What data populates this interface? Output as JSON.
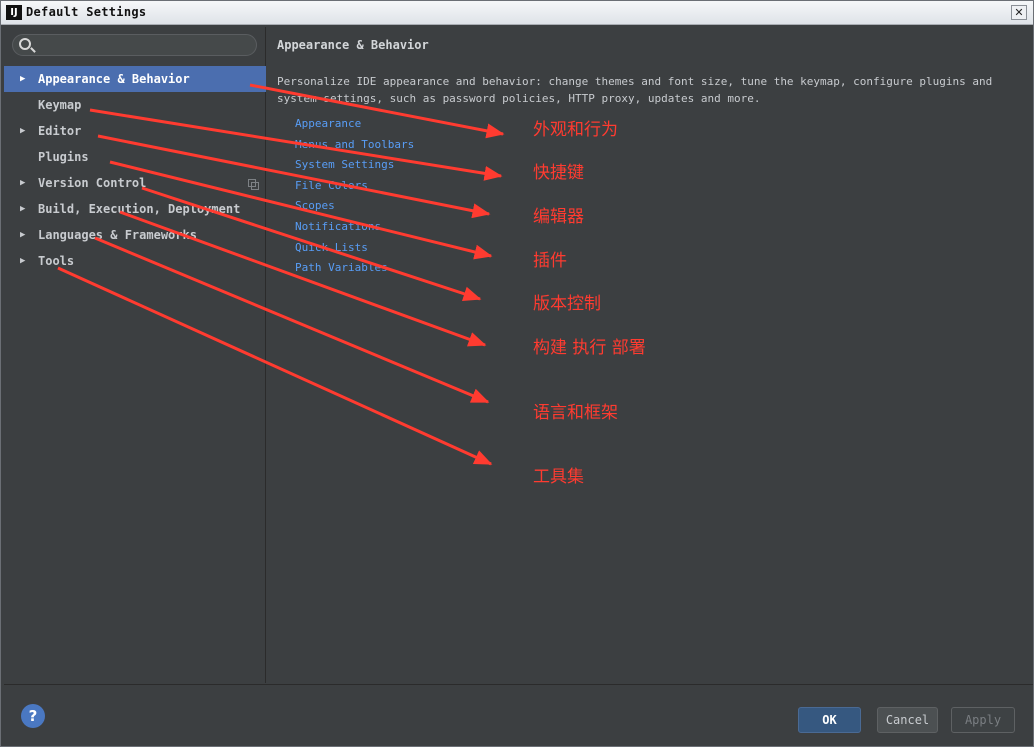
{
  "window": {
    "title": "Default Settings",
    "app_icon_text": "IJ",
    "close_symbol": "✕"
  },
  "sidebar": {
    "search_placeholder": "",
    "items": [
      {
        "label": "Appearance & Behavior",
        "expandable": true,
        "selected": true
      },
      {
        "label": "Keymap",
        "expandable": false,
        "selected": false
      },
      {
        "label": "Editor",
        "expandable": true,
        "selected": false
      },
      {
        "label": "Plugins",
        "expandable": false,
        "selected": false
      },
      {
        "label": "Version Control",
        "expandable": true,
        "selected": false
      },
      {
        "label": "Build, Execution, Deployment",
        "expandable": true,
        "selected": false
      },
      {
        "label": "Languages & Frameworks",
        "expandable": true,
        "selected": false
      },
      {
        "label": "Tools",
        "expandable": true,
        "selected": false
      }
    ],
    "arrow_symbol": "▶"
  },
  "content": {
    "breadcrumb": "Appearance & Behavior",
    "description": "Personalize IDE appearance and behavior: change themes and font size, tune the keymap, configure plugins and system settings, such as password policies, HTTP proxy, updates and more.",
    "links": [
      "Appearance",
      "Menus and Toolbars",
      "System Settings",
      "File Colors",
      "Scopes",
      "Notifications",
      "Quick Lists",
      "Path Variables"
    ]
  },
  "buttons": {
    "help": "?",
    "ok": "OK",
    "cancel": "Cancel",
    "apply": "Apply"
  },
  "annotations": {
    "color": "#ff3b30",
    "labels": [
      "外观和行为",
      "快捷键",
      "编辑器",
      "插件",
      "版本控制",
      "构建 执行 部署",
      "语言和框架",
      "工具集"
    ]
  },
  "colors": {
    "selection": "#4b6eaf",
    "link": "#589df6",
    "background": "#3c3f41"
  }
}
